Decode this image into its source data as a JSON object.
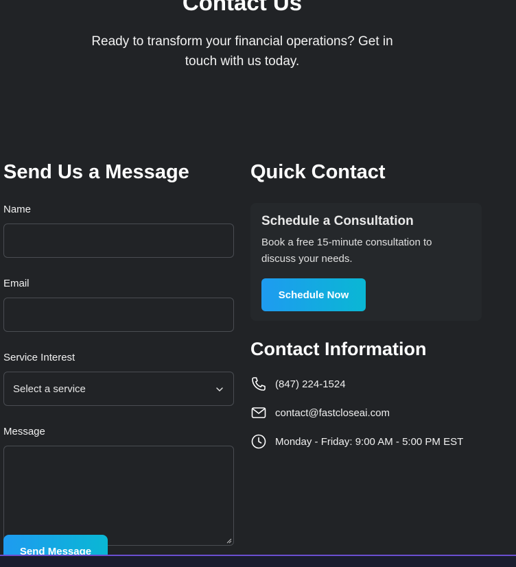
{
  "hero": {
    "title": "Contact Us",
    "subtitle": "Ready to transform your financial operations? Get in touch with us today."
  },
  "form": {
    "heading": "Send Us a Message",
    "name_label": "Name",
    "email_label": "Email",
    "service_label": "Service Interest",
    "service_selected": "Select a service",
    "message_label": "Message",
    "submit_label": "Send Message"
  },
  "quick_contact": {
    "heading": "Quick Contact",
    "card_title": "Schedule a Consultation",
    "card_text": "Book a free 15-minute consultation to discuss your needs.",
    "card_button": "Schedule Now"
  },
  "contact_info": {
    "heading": "Contact Information",
    "phone": "(847) 224-1524",
    "email": "contact@fastcloseai.com",
    "hours": "Monday - Friday: 9:00 AM - 5:00 PM EST"
  },
  "icons": {
    "phone": "phone-icon",
    "email": "mail-icon",
    "hours": "clock-icon",
    "select": "chevron-down-icon"
  },
  "colors": {
    "background": "#212326",
    "button_gradient_start": "#1e9bf0",
    "button_gradient_end": "#0ab7d4",
    "accent_line": "#6b4fd0"
  }
}
